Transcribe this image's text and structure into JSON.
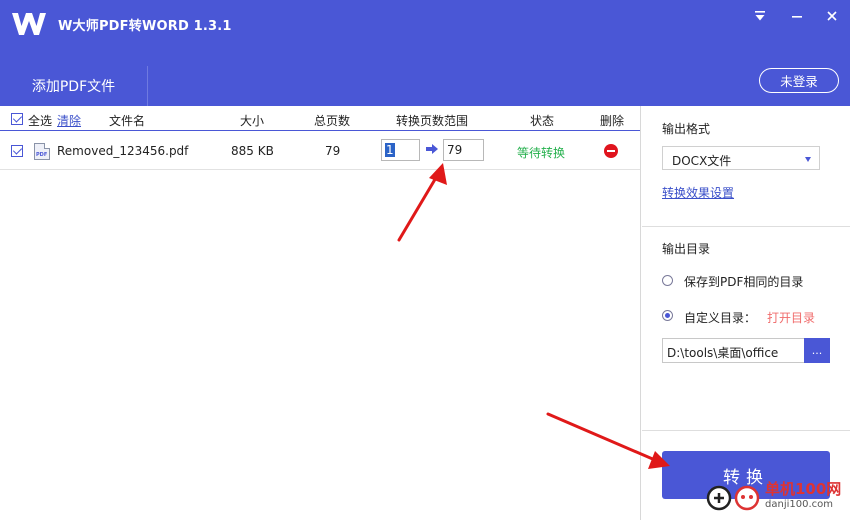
{
  "app": {
    "title": "W大师PDF转WORD 1.3.1"
  },
  "header": {
    "add_tab": "添加PDF文件",
    "login": "未登录"
  },
  "list": {
    "select_all": "全选",
    "clear": "清除",
    "columns": [
      "文件名",
      "大小",
      "总页数",
      "转换页数范围",
      "状态",
      "删除"
    ],
    "rows": [
      {
        "name": "Removed_123456.pdf",
        "size": "885 KB",
        "pages": "79",
        "from": "1",
        "to": "79",
        "status": "等待转换"
      }
    ]
  },
  "side": {
    "format_label": "输出格式",
    "format_value": "DOCX文件",
    "effect_settings": "转换效果设置",
    "dir_label": "输出目录",
    "option_same": "保存到PDF相同的目录",
    "option_custom": "自定义目录：",
    "open_dir": "打开目录",
    "path": "D:\\tools\\桌面\\office",
    "browse": "...",
    "convert": "转换"
  },
  "watermark": {
    "main": "单机100网",
    "sub": "danji100.com"
  },
  "colors": {
    "brand": "#4a57d6",
    "status_green": "#24b04c",
    "delete_red": "#e0141e",
    "annotation_red": "#e01919"
  }
}
